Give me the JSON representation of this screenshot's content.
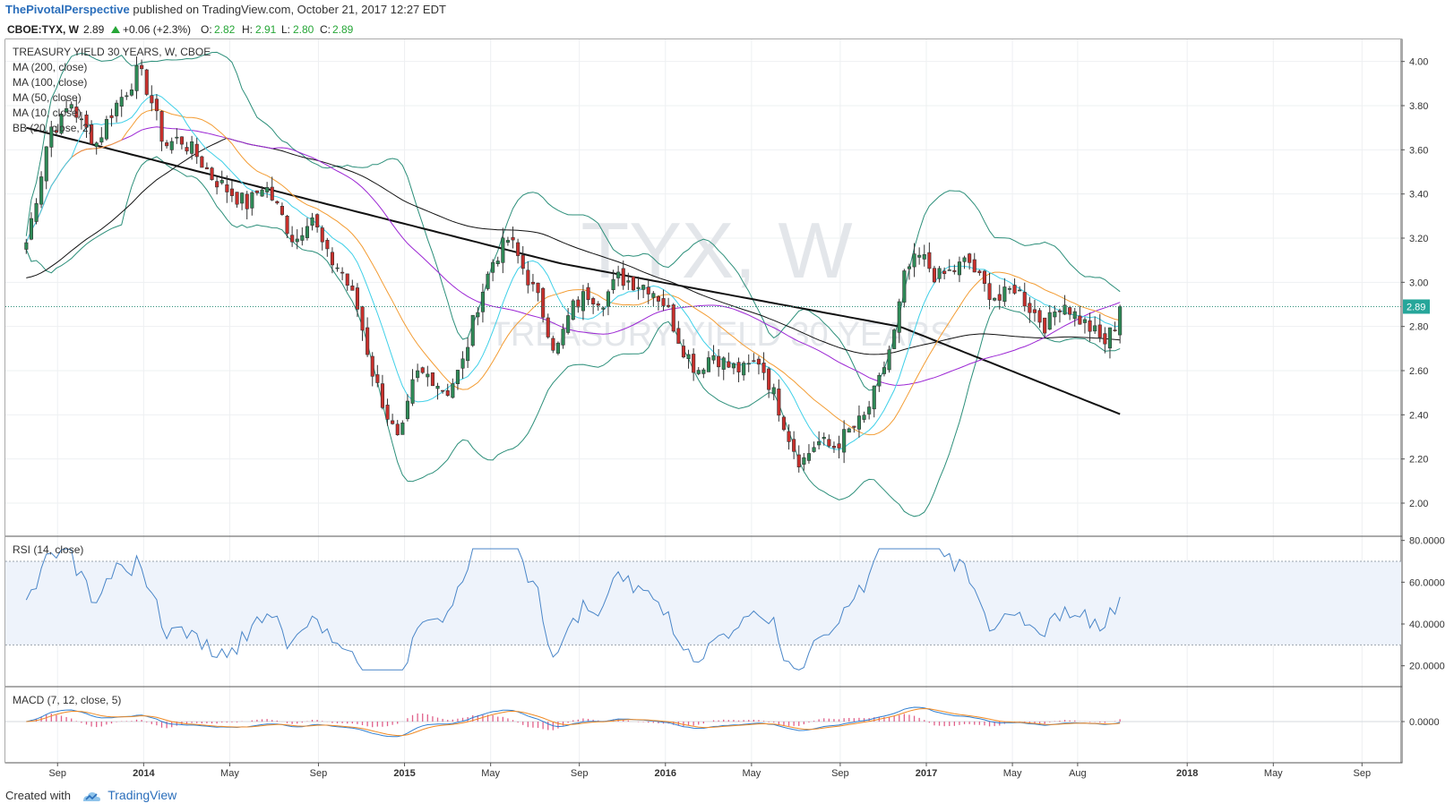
{
  "header": {
    "author": "ThePivotalPerspective",
    "published": "published on TradingView.com, October 21, 2017 12:27 EDT"
  },
  "quote": {
    "symbol": "CBOE:TYX, W",
    "last": "2.89",
    "change": "+0.06 (+2.3%)",
    "o_label": "O:",
    "o": "2.82",
    "h_label": "H:",
    "h": "2.91",
    "l_label": "L:",
    "l": "2.80",
    "c_label": "C:",
    "c": "2.89",
    "up_color": "#26a637"
  },
  "legend": {
    "title": "TREASURY YIELD 30 YEARS, W, CBOE",
    "ma200": "MA (200, close)",
    "ma100": "MA (100, close)",
    "ma50": "MA (50, close)",
    "ma10": "MA (10, close)",
    "bb": "BB (20, close, 2)"
  },
  "watermark": {
    "symbol": "TYX, W",
    "name": "TREASURY YIELD 30 YEARS"
  },
  "price_label": "2.89",
  "rsi_label": "RSI (14, close)",
  "macd_label": "MACD (7, 12, close, 5)",
  "x_ticks": [
    "Sep",
    "2014",
    "May",
    "Sep",
    "2015",
    "May",
    "Sep",
    "2016",
    "May",
    "Sep",
    "2017",
    "May",
    "Aug",
    "2018",
    "May",
    "Sep"
  ],
  "footer": {
    "created": "Created with",
    "brand": "TradingView"
  },
  "chart_data": [
    {
      "type": "candlestick",
      "title": "TREASURY YIELD 30 YEARS, W, CBOE",
      "ylim": [
        1.85,
        4.1
      ],
      "y_ticks": [
        "4.00",
        "3.80",
        "3.60",
        "3.40",
        "3.20",
        "3.00",
        "2.80",
        "2.60",
        "2.40",
        "2.20",
        "2.00"
      ],
      "last_close": 2.89,
      "close_path": [
        [
          2013.55,
          3.18
        ],
        [
          2013.6,
          3.45
        ],
        [
          2013.64,
          3.7
        ],
        [
          2013.68,
          3.72
        ],
        [
          2013.72,
          3.82
        ],
        [
          2013.76,
          3.72
        ],
        [
          2013.82,
          3.63
        ],
        [
          2013.88,
          3.78
        ],
        [
          2013.94,
          3.88
        ],
        [
          2013.98,
          3.96
        ],
        [
          2014.02,
          3.86
        ],
        [
          2014.08,
          3.62
        ],
        [
          2014.14,
          3.65
        ],
        [
          2014.2,
          3.58
        ],
        [
          2014.26,
          3.48
        ],
        [
          2014.32,
          3.42
        ],
        [
          2014.4,
          3.35
        ],
        [
          2014.46,
          3.45
        ],
        [
          2014.52,
          3.32
        ],
        [
          2014.58,
          3.18
        ],
        [
          2014.64,
          3.32
        ],
        [
          2014.7,
          3.12
        ],
        [
          2014.76,
          3.05
        ],
        [
          2014.82,
          2.88
        ],
        [
          2014.88,
          2.58
        ],
        [
          2014.94,
          2.38
        ],
        [
          2014.98,
          2.26
        ],
        [
          2015.04,
          2.58
        ],
        [
          2015.1,
          2.58
        ],
        [
          2015.16,
          2.5
        ],
        [
          2015.22,
          2.62
        ],
        [
          2015.28,
          2.9
        ],
        [
          2015.34,
          3.1
        ],
        [
          2015.4,
          3.2
        ],
        [
          2015.46,
          3.05
        ],
        [
          2015.52,
          2.9
        ],
        [
          2015.58,
          2.68
        ],
        [
          2015.64,
          2.88
        ],
        [
          2015.7,
          2.95
        ],
        [
          2015.76,
          2.92
        ],
        [
          2015.82,
          3.02
        ],
        [
          2015.88,
          3.0
        ],
        [
          2015.94,
          2.98
        ],
        [
          2016.0,
          2.9
        ],
        [
          2016.06,
          2.72
        ],
        [
          2016.12,
          2.6
        ],
        [
          2016.18,
          2.68
        ],
        [
          2016.24,
          2.62
        ],
        [
          2016.3,
          2.6
        ],
        [
          2016.36,
          2.65
        ],
        [
          2016.42,
          2.48
        ],
        [
          2016.48,
          2.28
        ],
        [
          2016.52,
          2.18
        ],
        [
          2016.58,
          2.28
        ],
        [
          2016.64,
          2.25
        ],
        [
          2016.7,
          2.32
        ],
        [
          2016.76,
          2.38
        ],
        [
          2016.82,
          2.55
        ],
        [
          2016.88,
          2.78
        ],
        [
          2016.92,
          3.05
        ],
        [
          2016.98,
          3.12
        ],
        [
          2017.04,
          3.02
        ],
        [
          2017.1,
          3.05
        ],
        [
          2017.16,
          3.1
        ],
        [
          2017.22,
          2.98
        ],
        [
          2017.28,
          2.92
        ],
        [
          2017.34,
          2.98
        ],
        [
          2017.4,
          2.88
        ],
        [
          2017.46,
          2.8
        ],
        [
          2017.52,
          2.92
        ],
        [
          2017.58,
          2.84
        ],
        [
          2017.64,
          2.78
        ],
        [
          2017.68,
          2.72
        ],
        [
          2017.72,
          2.8
        ],
        [
          2017.76,
          2.89
        ]
      ]
    },
    {
      "type": "line",
      "title": "RSI (14, close)",
      "ylim": [
        10,
        82
      ],
      "y_ticks": [
        "80.0000",
        "60.0000",
        "40.0000",
        "20.0000"
      ],
      "bands": [
        30,
        70
      ]
    },
    {
      "type": "bar",
      "title": "MACD (7, 12, close, 5)",
      "y_ticks": [
        "0.0000"
      ]
    }
  ]
}
